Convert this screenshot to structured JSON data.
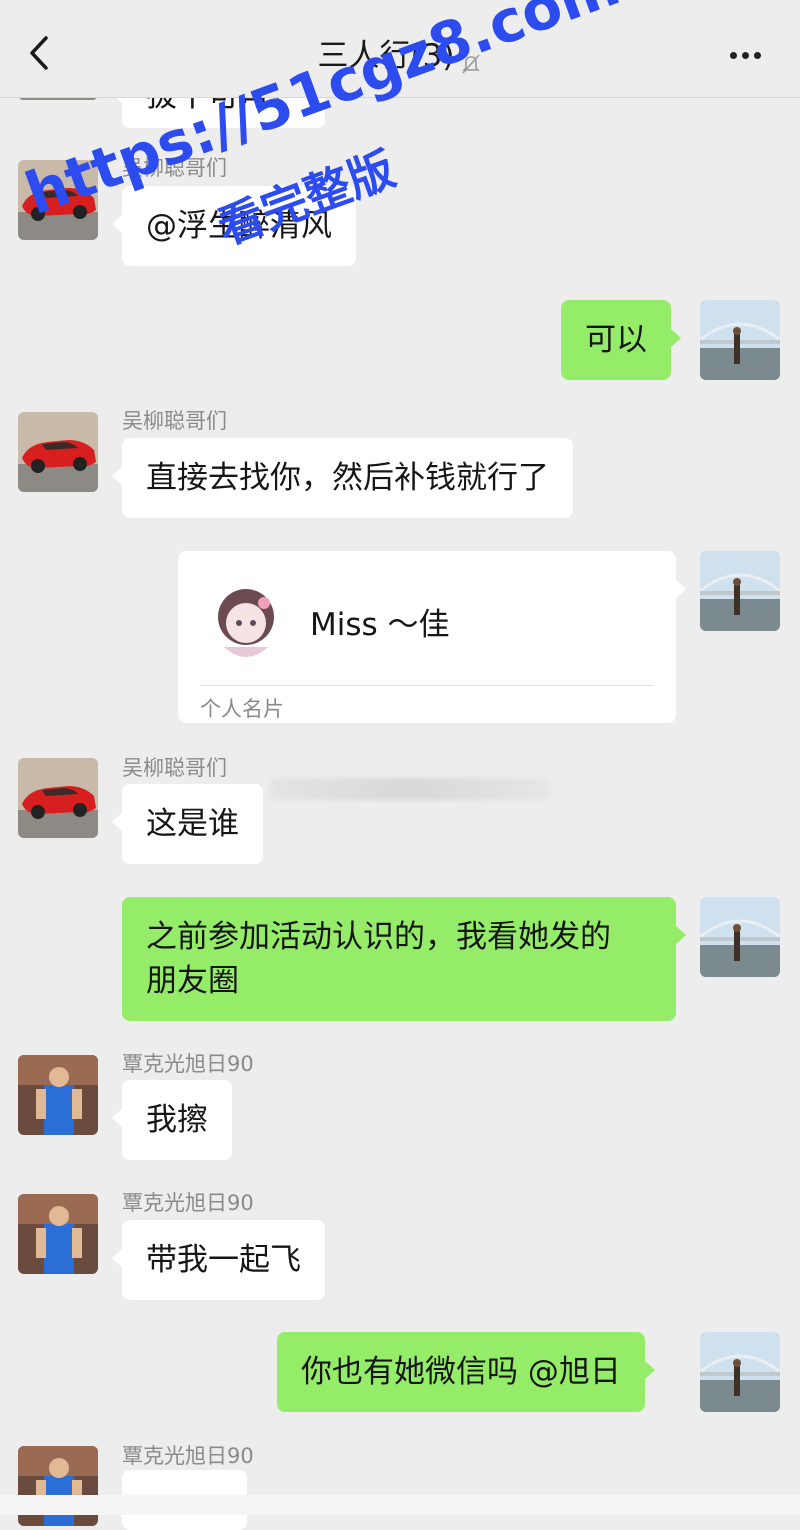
{
  "header": {
    "title": "三人行(3)"
  },
  "watermark": {
    "line1": "https://51cgz8.com",
    "line2": "看完整版"
  },
  "messages": [
    {
      "id": "m0",
      "side": "left",
      "text": "拔干可可！"
    },
    {
      "id": "m1",
      "side": "left",
      "sender": "吴柳聪哥们",
      "text": "@浮生醉清风"
    },
    {
      "id": "m2",
      "side": "right",
      "text": "可以"
    },
    {
      "id": "m3",
      "side": "left",
      "sender": "吴柳聪哥们",
      "text": "直接去找你，然后补钱就行了"
    },
    {
      "id": "m4",
      "side": "right",
      "type": "card",
      "card_name": "Miss ～佳",
      "card_label": "个人名片"
    },
    {
      "id": "m5",
      "side": "left",
      "sender": "吴柳聪哥们",
      "text": "这是谁"
    },
    {
      "id": "m6",
      "side": "right",
      "text_line1": "之前参加活动认识的，我看她发的",
      "text_line2": "朋友圈"
    },
    {
      "id": "m7",
      "side": "left",
      "sender": "覃克光旭日90",
      "text": "我擦"
    },
    {
      "id": "m8",
      "side": "left",
      "sender": "覃克光旭日90",
      "text": "带我一起飞"
    },
    {
      "id": "m9",
      "side": "right",
      "text": "你也有她微信吗 @旭日"
    },
    {
      "id": "m10",
      "side": "left",
      "sender": "覃克光旭日90",
      "text": ""
    }
  ],
  "icons": {
    "back": "back-arrow-icon",
    "mute": "bell-mute-icon",
    "more": "more-dots-icon"
  },
  "colors": {
    "background": "#ededed",
    "bubble_self": "#95ec69",
    "bubble_other": "#ffffff",
    "watermark": "#2d4cf0"
  }
}
